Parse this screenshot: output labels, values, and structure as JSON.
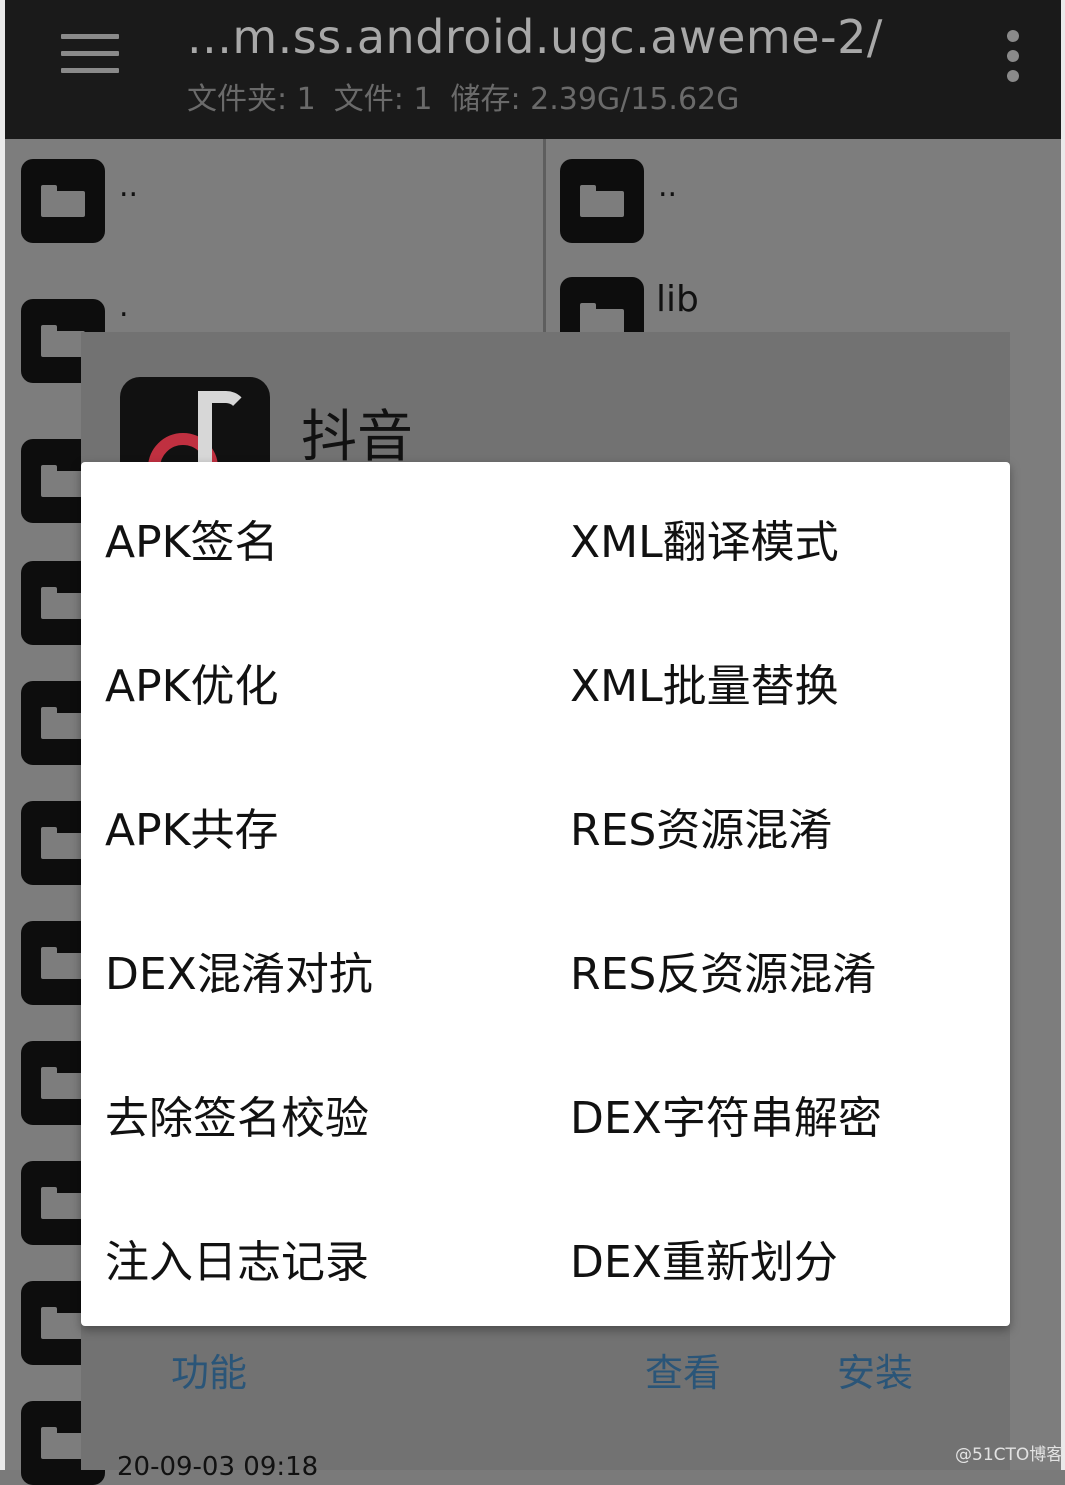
{
  "toolbar": {
    "path_title": "...m.ss.android.ugc.aweme-2/",
    "folder_count": "文件夹: 1",
    "file_count": "文件: 1",
    "storage": "储存: 2.39G/15.62G",
    "menu_icon": "hamburger-menu-icon",
    "more_icon": "more-vertical-icon"
  },
  "left_pane": {
    "items": [
      {
        "name": ".."
      },
      {
        "name": "."
      }
    ]
  },
  "right_pane": {
    "items": [
      {
        "name": ".."
      },
      {
        "name": "lib"
      }
    ]
  },
  "app_dialog": {
    "app_name": "抖音",
    "buttons": {
      "functions": "功能",
      "view": "查看",
      "install": "安装"
    },
    "bottom_text": "20-09-03 09:18"
  },
  "function_menu": {
    "left_column": [
      "APK签名",
      "APK优化",
      "APK共存",
      "DEX混淆对抗",
      "去除签名校验",
      "注入日志记录"
    ],
    "right_column": [
      "XML翻译模式",
      "XML批量替换",
      "RES资源混淆",
      "RES反资源混淆",
      "DEX字符串解密",
      "DEX重新划分"
    ]
  },
  "watermark": "@51CTO博客",
  "colors": {
    "toolbar_bg": "#1a1a1a",
    "accent_button": "#2a5578",
    "popup_bg": "#ffffff"
  }
}
